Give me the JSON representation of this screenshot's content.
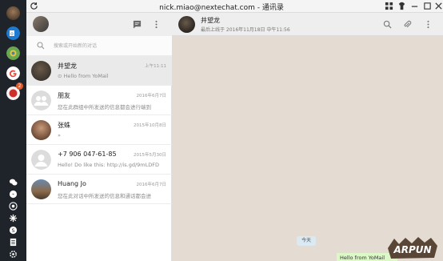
{
  "titlebar": {
    "title": "nick.miao@nextechat.com - 通讯录"
  },
  "rail": {
    "badge_count": "2",
    "apps": [
      "profile-avatar",
      "outlook",
      "chrome-like",
      "google",
      "yomail"
    ],
    "bottom_icons": [
      "wechat-icon",
      "messenger-icon",
      "whatsapp-icon",
      "slack-icon",
      "skype-icon",
      "document-icon",
      "settings-icon"
    ]
  },
  "search": {
    "placeholder": "搜索或开始新的对话"
  },
  "chats": [
    {
      "name": "井望龙",
      "time": "上午11:11",
      "preview": "⊙ Hello from YoMail",
      "active": true
    },
    {
      "name": "朋友",
      "time": "2016年6月7日",
      "preview": "您在此群组中所发送的信息都会进行端到",
      "active": false
    },
    {
      "name": "张蛛",
      "time": "2015年10月8日",
      "preview": "»",
      "active": false
    },
    {
      "name": "+7 906 047-61-85",
      "time": "2015年5月30日",
      "preview": "Hello! Do like this: http://is.gd/9mLDFD",
      "active": false
    },
    {
      "name": "Huang Jo",
      "time": "2016年6月7日",
      "preview": "您在此对话中所发送的信息和通话都会进",
      "active": false
    }
  ],
  "conversation": {
    "name": "井望龙",
    "status": "最后上线于 2016年11月18日 中午11:56",
    "date_chip": "今天",
    "last_message": "Hello from YoMail",
    "watermark": "ARPUN"
  },
  "colors": {
    "rail": "#1f232a",
    "conv_bg": "#e4dcd3",
    "bubble": "#dcf8c6",
    "badge": "#e05b2b"
  }
}
